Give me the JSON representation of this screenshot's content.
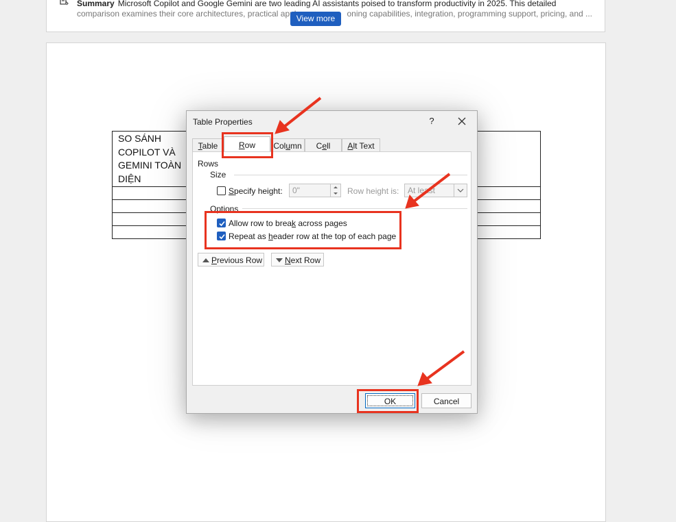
{
  "summary": {
    "label": "Summary",
    "line1": "Microsoft Copilot and Google Gemini are two leading AI assistants poised to transform productivity in 2025. This detailed",
    "line2": "comparison examines their core architectures, practical appl",
    "line2_tail": "oning capabilities, integration, programming support, pricing, and ...",
    "view_more": "View more"
  },
  "document": {
    "table_title": "SO SÁNH COPILOT VÀ GEMINI TOÀN DIỆN",
    "table_title_lines": [
      "SO SÁNH",
      "COPILOT VÀ",
      "GEMINI TOÀN",
      "DIỆN"
    ]
  },
  "dialog": {
    "title": "Table Properties",
    "help": "?",
    "tabs": [
      {
        "pre": "",
        "u": "T",
        "post": "able"
      },
      {
        "pre": "",
        "u": "R",
        "post": "ow"
      },
      {
        "pre": "Col",
        "u": "u",
        "post": "mn"
      },
      {
        "pre": "C",
        "u": "e",
        "post": "ll"
      },
      {
        "pre": "",
        "u": "A",
        "post": "lt Text"
      }
    ],
    "active_tab": "Row",
    "rows_label": "Rows",
    "size_label": "Size",
    "specify_height": {
      "pre": "",
      "u": "S",
      "post": "pecify height:",
      "checked": false
    },
    "height_value": "0\"",
    "row_height_is": "Row height is:",
    "row_height_mode": "At least",
    "options_label": "Options",
    "allow_break": {
      "pre": "Allow row to brea",
      "u": "k",
      "post": " across pages",
      "checked": true
    },
    "repeat_header": {
      "pre": "Repeat as ",
      "u": "h",
      "post": "eader row at the top of each page",
      "checked": true
    },
    "previous_row": {
      "pre": "",
      "u": "P",
      "post": "revious Row"
    },
    "next_row": {
      "pre": "",
      "u": "N",
      "post": "ext Row"
    },
    "ok": "OK",
    "cancel": "Cancel"
  },
  "colors": {
    "highlight": "#e8331f",
    "accent": "#1f5fbf"
  }
}
